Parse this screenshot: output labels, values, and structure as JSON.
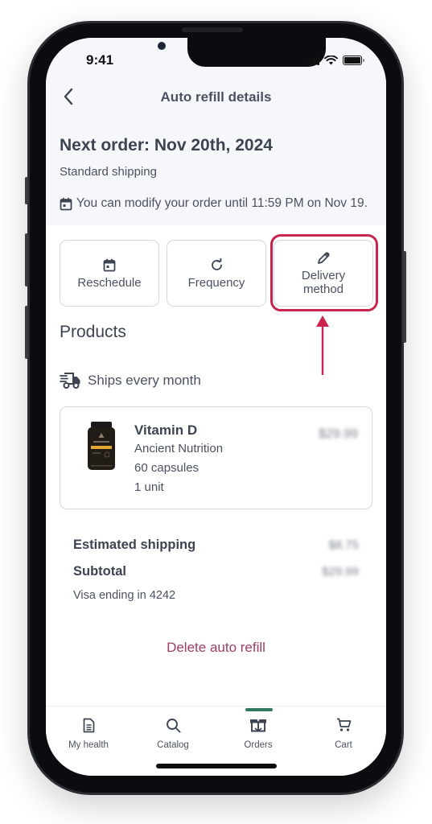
{
  "status_bar": {
    "time": "9:41"
  },
  "nav": {
    "title": "Auto refill details",
    "back_icon": "chevron-left-icon"
  },
  "order": {
    "next_order": "Next order: Nov 20th, 2024",
    "shipping_type": "Standard shipping",
    "modify_note": "You can modify your order until 11:59 PM on Nov 19."
  },
  "actions": [
    {
      "label": "Reschedule",
      "icon": "calendar-icon"
    },
    {
      "label": "Frequency",
      "icon": "refresh-icon"
    },
    {
      "label_line1": "Delivery",
      "label_line2": "method",
      "icon": "pencil-icon",
      "highlighted": true
    }
  ],
  "annotation": {
    "highlight_color": "#c8244e"
  },
  "products": {
    "title": "Products",
    "ships_every": "Ships every month",
    "items": [
      {
        "name": "Vitamin D",
        "brand": "Ancient Nutrition",
        "size": "60 capsules",
        "quantity": "1 unit",
        "price": "$29.99"
      }
    ]
  },
  "summary": {
    "shipping_label": "Estimated shipping",
    "shipping_value": "$8.75",
    "subtotal_label": "Subtotal",
    "subtotal_value": "$29.99",
    "payment_note": "Visa ending in 4242"
  },
  "delete_label": "Delete auto refill",
  "colors": {
    "delete": "#9c3e64",
    "active_tab": "#2f7a5c",
    "header_bg": "#f6f7fb"
  },
  "tabbar": {
    "items": [
      {
        "label": "My health",
        "icon": "document-icon"
      },
      {
        "label": "Catalog",
        "icon": "search-icon"
      },
      {
        "label": "Orders",
        "icon": "box-icon",
        "active": true
      },
      {
        "label": "Cart",
        "icon": "cart-icon"
      }
    ]
  }
}
